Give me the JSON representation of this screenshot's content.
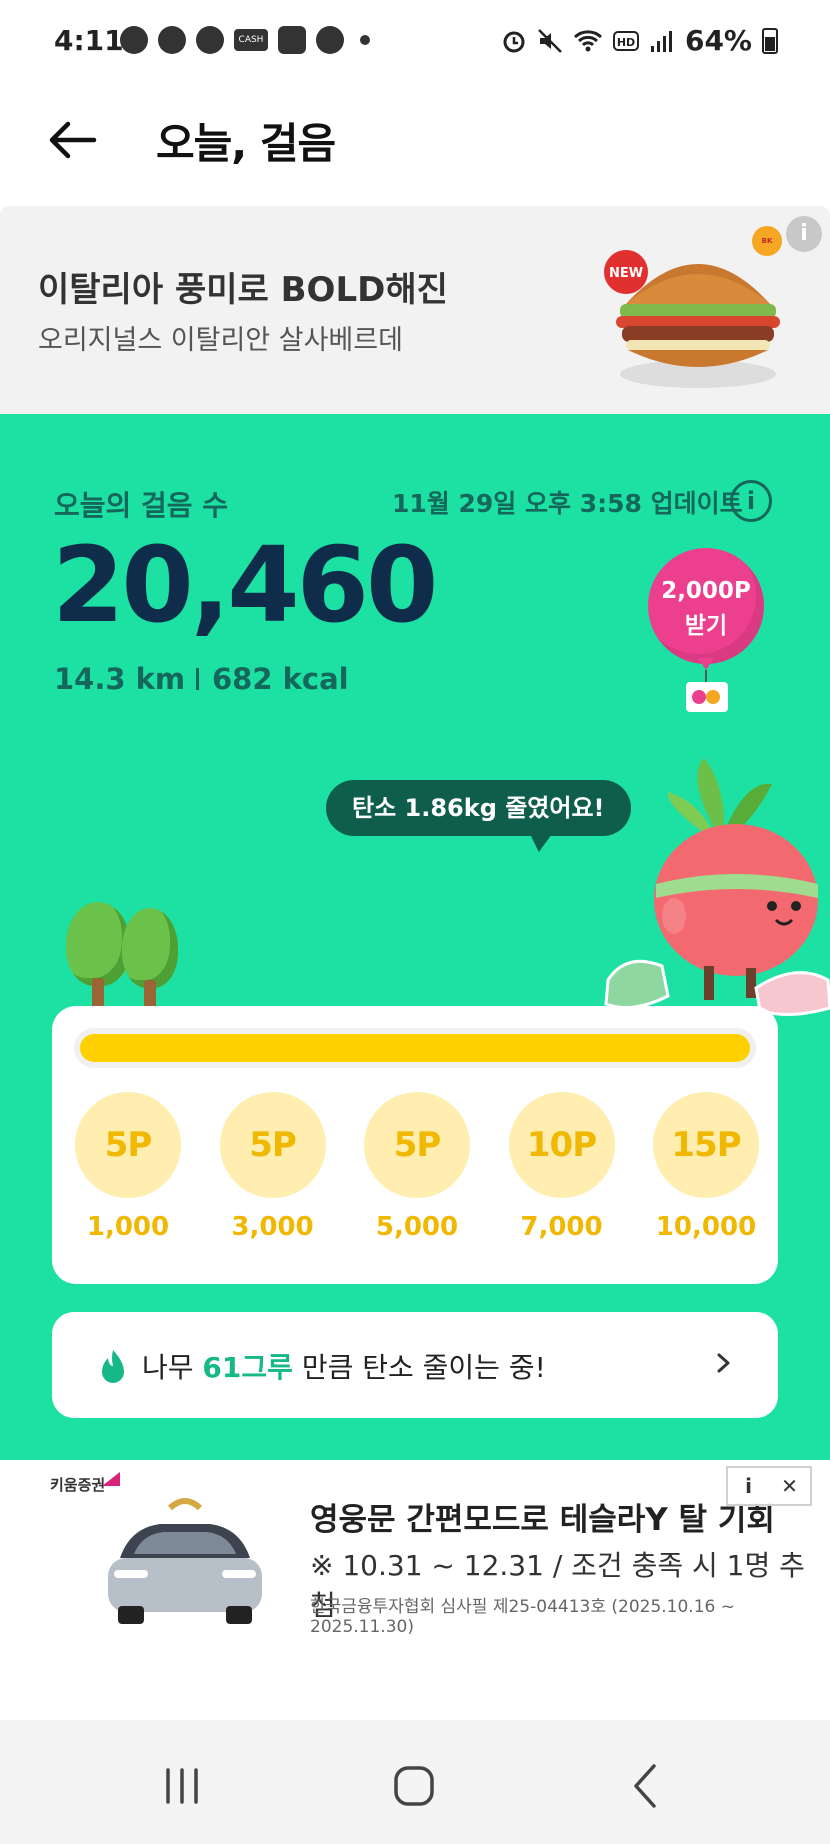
{
  "status_bar": {
    "time": "4:11",
    "battery": "64%"
  },
  "header": {
    "title": "오늘, 걸음",
    "back_icon": "arrow-left-icon"
  },
  "ad_top": {
    "title": "이탈리아 풍미로 BOLD해진",
    "subtitle": "오리지널스 이탈리안 살사베르데",
    "badge": "NEW",
    "brand": "BURGER KING",
    "info_icon": "info-icon"
  },
  "steps": {
    "label": "오늘의 걸음 수",
    "updated": "11월 29일 오후 3:58 업데이트",
    "count": "20,460",
    "distance": "14.3 km",
    "calories": "682 kcal",
    "reward_balloon": [
      "2,000P",
      "받기"
    ]
  },
  "speech_bubble": "탄소 1.86kg 줄였어요!",
  "progress": {
    "fraction": 1.0,
    "milestones": [
      {
        "points": "5P",
        "steps": "1,000"
      },
      {
        "points": "5P",
        "steps": "3,000"
      },
      {
        "points": "5P",
        "steps": "5,000"
      },
      {
        "points": "10P",
        "steps": "7,000"
      },
      {
        "points": "15P",
        "steps": "10,000"
      }
    ]
  },
  "tree_banner": {
    "prefix": "나무 ",
    "highlight": "61그루",
    "suffix": " 만큼 탄소 줄이는 중!"
  },
  "ad_bottom": {
    "brand": "키움증권",
    "title": "영웅문 간편모드로 테슬라Y 탈 기회",
    "subtitle": "※ 10.31 ~ 12.31 / 조건 충족 시 1명 추첨",
    "note": "한국금융투자협회 심사필 제25-04413호 (2025.10.16 ~ 2025.11.30)",
    "info_label": "i",
    "close_label": "✕"
  },
  "colors": {
    "green_bg": "#1de0a3",
    "accent_pink": "#ec3f8e",
    "progress_yellow": "#ffd000"
  }
}
